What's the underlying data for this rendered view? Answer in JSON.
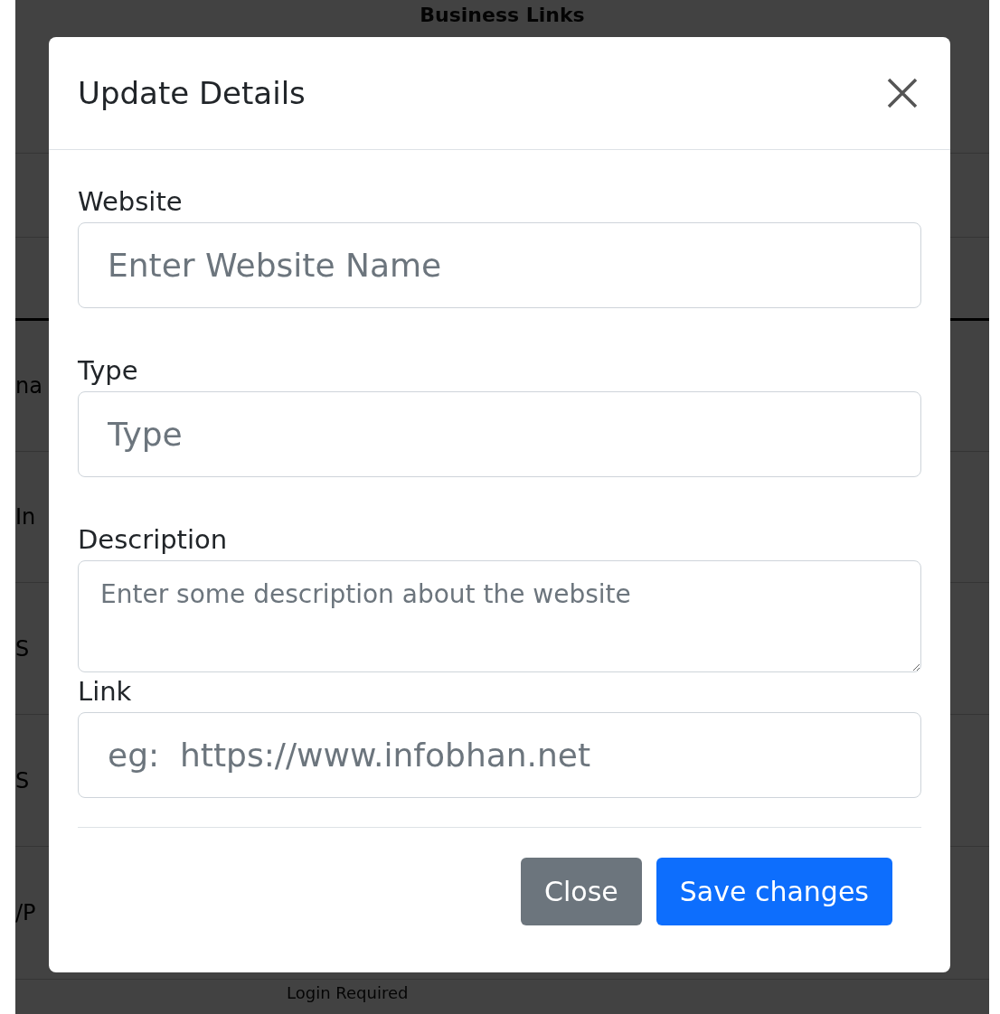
{
  "background": {
    "heading": "Business Links",
    "rows": [
      {
        "text": "na"
      },
      {
        "text": "In"
      },
      {
        "text": "S"
      },
      {
        "text": "S"
      },
      {
        "text": "/P"
      }
    ],
    "last_cell": "Login Required"
  },
  "modal": {
    "title": "Update Details",
    "fields": [
      {
        "kind": "input",
        "label": "Website",
        "placeholder": "Enter Website Name"
      },
      {
        "kind": "input",
        "label": "Type",
        "placeholder": "Type"
      },
      {
        "kind": "textarea",
        "label": "Description",
        "placeholder": "Enter some description about the website"
      },
      {
        "kind": "input",
        "label": "Link",
        "placeholder": "eg:  https://www.infobhan.net"
      }
    ],
    "buttons": [
      {
        "label": "Close",
        "kind": "secondary"
      },
      {
        "label": "Save changes",
        "kind": "primary"
      }
    ]
  }
}
